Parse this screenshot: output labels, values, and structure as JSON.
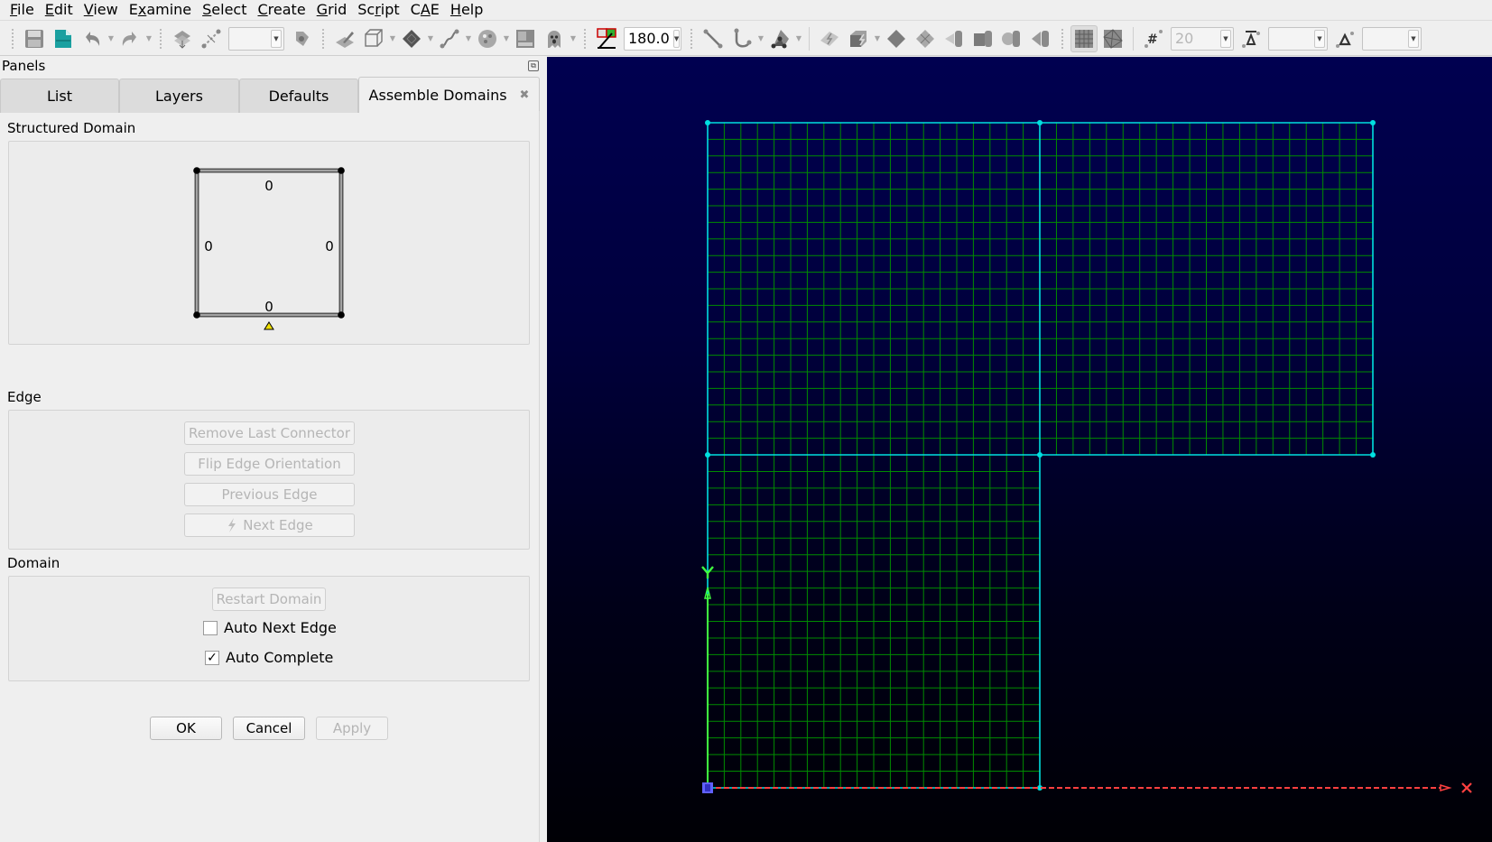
{
  "menubar": {
    "items": [
      {
        "label": "File",
        "mnemonic": "F"
      },
      {
        "label": "Edit",
        "mnemonic": "E"
      },
      {
        "label": "View",
        "mnemonic": "V"
      },
      {
        "label": "Examine",
        "mnemonic": "x"
      },
      {
        "label": "Select",
        "mnemonic": "S"
      },
      {
        "label": "Create",
        "mnemonic": "C"
      },
      {
        "label": "Grid",
        "mnemonic": "G"
      },
      {
        "label": "Script",
        "mnemonic": "r"
      },
      {
        "label": "CAE",
        "mnemonic": "A"
      },
      {
        "label": "Help",
        "mnemonic": "H"
      }
    ]
  },
  "toolbar": {
    "icons": [
      "save-icon",
      "save-as-icon",
      "undo-icon",
      "redo-icon",
      "select-mask-icon",
      "connector-select-icon",
      "transform-icon",
      "edit-icon",
      "box-view-icon",
      "shade-icon",
      "curve-icon",
      "color-icon",
      "layer-icon",
      "ghost-icon",
      "angle-icon",
      "line-icon",
      "spline-icon",
      "solid-icon",
      "assemble-domain-icon",
      "assemble-block-icon",
      "domain-icon",
      "domain-struct-icon",
      "solve-domain-icon",
      "solve-block-icon",
      "solve-edge-icon",
      "solve-conn-icon",
      "structured-grid-icon",
      "unstructured-grid-icon",
      "dimension-icon",
      "spacing-icon",
      "delta-icon"
    ],
    "angle_value": "180.0",
    "layer_combo": "",
    "dimension_value": "20",
    "spacing_value": "",
    "delta_value": ""
  },
  "panels": {
    "title": "Panels",
    "tabs": [
      {
        "label": "List",
        "active": false
      },
      {
        "label": "Layers",
        "active": false
      },
      {
        "label": "Defaults",
        "active": false
      },
      {
        "label": "Assemble Domains",
        "active": true,
        "closable": true
      }
    ],
    "structured_domain": {
      "label": "Structured Domain",
      "edge_counts": {
        "top": "0",
        "left": "0",
        "right": "0",
        "bottom": "0"
      }
    },
    "edge": {
      "label": "Edge",
      "buttons": [
        {
          "label": "Remove Last Connector",
          "enabled": false
        },
        {
          "label": "Flip Edge Orientation",
          "enabled": false
        },
        {
          "label": "Previous Edge",
          "enabled": false
        },
        {
          "label": "Next Edge",
          "enabled": false
        }
      ]
    },
    "domain": {
      "label": "Domain",
      "restart_label": "Restart Domain",
      "auto_next_edge": {
        "label": "Auto Next Edge",
        "checked": false
      },
      "auto_complete": {
        "label": "Auto Complete",
        "checked": true
      }
    },
    "actions": {
      "ok": "OK",
      "cancel": "Cancel",
      "apply": "Apply"
    }
  },
  "viewport": {
    "colors": {
      "grid": "#008c00",
      "connector": "#00e0e0",
      "x_axis": "#ff4040",
      "y_axis": "#40ff40",
      "origin": "#6060ff"
    },
    "axis_labels": {
      "x": "X",
      "y": "Y"
    },
    "mesh": {
      "lower_domain_cells": {
        "i": 20,
        "j": 20
      },
      "upper_left_domain_cells": {
        "i": 20,
        "j": 20
      },
      "upper_right_domain_cells": {
        "i": 20,
        "j": 20
      }
    }
  }
}
